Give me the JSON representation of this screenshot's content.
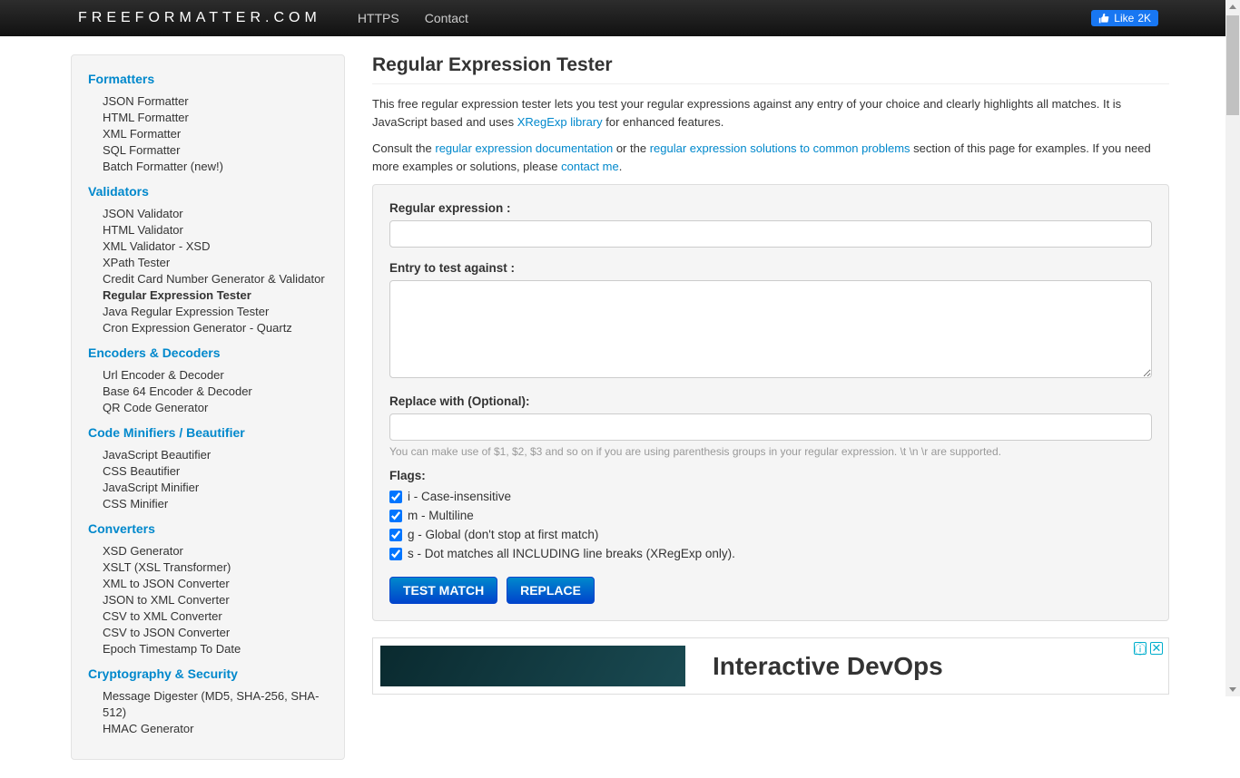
{
  "brand": "FREEFORMATTER.COM",
  "nav": {
    "https": "HTTPS",
    "contact": "Contact"
  },
  "fb": {
    "like": "Like",
    "count": "2K"
  },
  "sidebar": {
    "formatters": {
      "title": "Formatters",
      "items": [
        "JSON Formatter",
        "HTML Formatter",
        "XML Formatter",
        "SQL Formatter",
        "Batch Formatter (new!)"
      ]
    },
    "validators": {
      "title": "Validators",
      "items": [
        "JSON Validator",
        "HTML Validator",
        "XML Validator - XSD",
        "XPath Tester",
        "Credit Card Number Generator & Validator",
        "Regular Expression Tester",
        "Java Regular Expression Tester",
        "Cron Expression Generator - Quartz"
      ]
    },
    "encoders": {
      "title": "Encoders & Decoders",
      "items": [
        "Url Encoder & Decoder",
        "Base 64 Encoder & Decoder",
        "QR Code Generator"
      ]
    },
    "minifiers": {
      "title": "Code Minifiers / Beautifier",
      "items": [
        "JavaScript Beautifier",
        "CSS Beautifier",
        "JavaScript Minifier",
        "CSS Minifier"
      ]
    },
    "converters": {
      "title": "Converters",
      "items": [
        "XSD Generator",
        "XSLT (XSL Transformer)",
        "XML to JSON Converter",
        "JSON to XML Converter",
        "CSV to XML Converter",
        "CSV to JSON Converter",
        "Epoch Timestamp To Date"
      ]
    },
    "crypto": {
      "title": "Cryptography & Security",
      "items": [
        "Message Digester (MD5, SHA-256, SHA-512)",
        "HMAC Generator"
      ]
    }
  },
  "page": {
    "title": "Regular Expression Tester",
    "intro1a": "This free regular expression tester lets you test your regular expressions against any entry of your choice and clearly highlights all matches. It is JavaScript based and uses ",
    "intro1_link": "XRegExp library",
    "intro1b": " for enhanced features.",
    "intro2a": "Consult the ",
    "intro2_link1": "regular expression documentation",
    "intro2b": " or the ",
    "intro2_link2": "regular expression solutions to common problems",
    "intro2c": " section of this page for examples. If you need more examples or solutions, please ",
    "intro2_link3": "contact me",
    "intro2d": "."
  },
  "form": {
    "regex_label": "Regular expression :",
    "entry_label": "Entry to test against :",
    "replace_label": "Replace with (Optional):",
    "help": "You can make use of $1, $2, $3 and so on if you are using parenthesis groups in your regular expression. \\t \\n \\r are supported.",
    "flags_label": "Flags:",
    "flag_i": "i - Case-insensitive",
    "flag_m": "m - Multiline",
    "flag_g": "g - Global (don't stop at first match)",
    "flag_s": "s - Dot matches all INCLUDING line breaks (XRegExp only).",
    "btn_test": "TEST MATCH",
    "btn_replace": "REPLACE"
  },
  "ad": {
    "headline": "Interactive DevOps"
  }
}
